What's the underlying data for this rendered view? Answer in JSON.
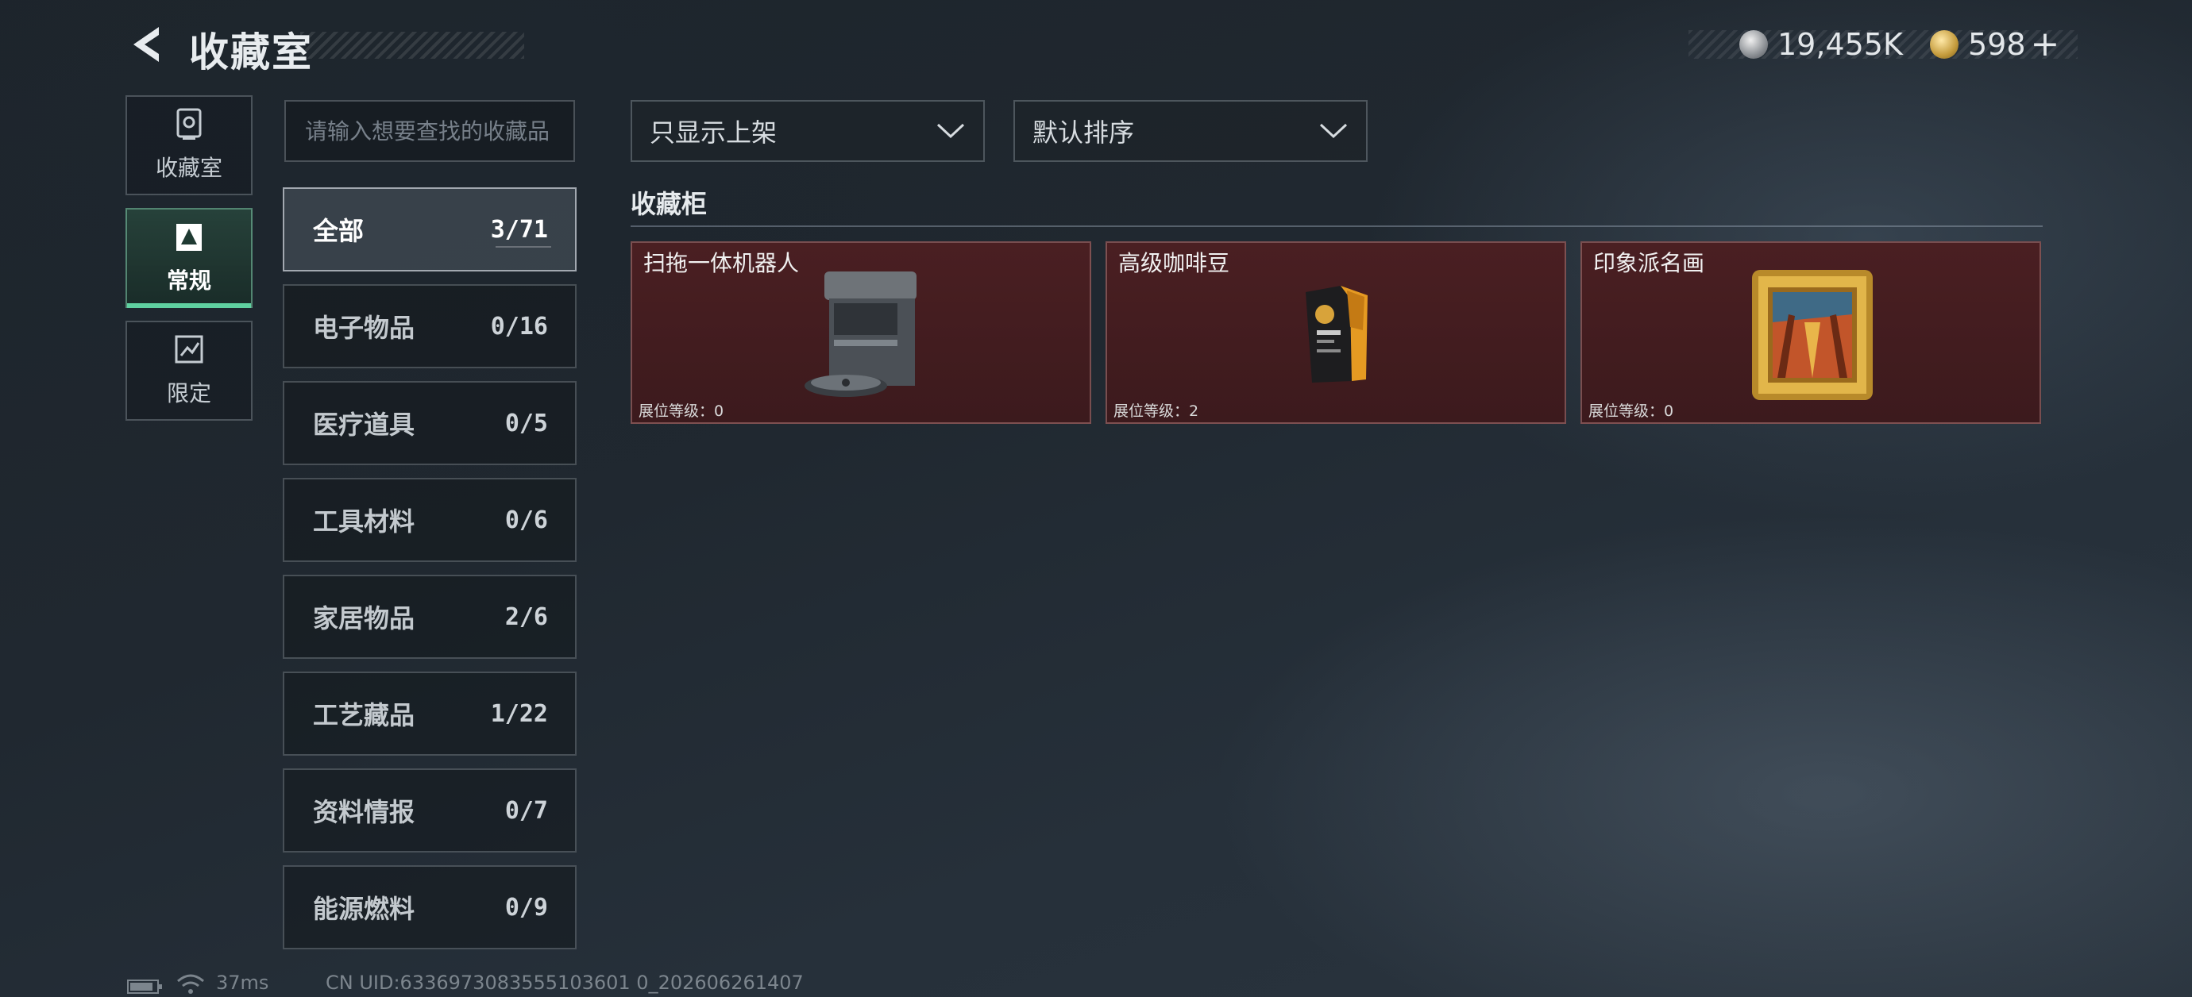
{
  "header": {
    "title": "收藏室",
    "currency": [
      {
        "icon": "silver-coin-icon",
        "value": "19,455K"
      },
      {
        "icon": "gold-coin-icon",
        "value": "598"
      }
    ],
    "plus": "+"
  },
  "nav": [
    {
      "label": "收藏室",
      "icon": "collection-room-icon",
      "active": false
    },
    {
      "label": "常规",
      "icon": "regular-icon",
      "active": true
    },
    {
      "label": "限定",
      "icon": "limited-icon",
      "active": false
    }
  ],
  "search": {
    "placeholder": "请输入想要查找的收藏品",
    "value": ""
  },
  "categories": [
    {
      "label": "全部",
      "count": "3/71",
      "active": true
    },
    {
      "label": "电子物品",
      "count": "0/16"
    },
    {
      "label": "医疗道具",
      "count": "0/5"
    },
    {
      "label": "工具材料",
      "count": "0/6"
    },
    {
      "label": "家居物品",
      "count": "2/6"
    },
    {
      "label": "工艺藏品",
      "count": "1/22"
    },
    {
      "label": "资料情报",
      "count": "0/7"
    },
    {
      "label": "能源燃料",
      "count": "0/9"
    }
  ],
  "filters": {
    "shelf": {
      "selected": "只显示上架"
    },
    "sort": {
      "selected": "默认排序"
    }
  },
  "section": {
    "title": "收藏柜"
  },
  "items": [
    {
      "name": "扫拖一体机器人",
      "level": "展位等级：0",
      "icon": "robot-vacuum-icon"
    },
    {
      "name": "高级咖啡豆",
      "level": "展位等级：2",
      "icon": "coffee-bag-icon"
    },
    {
      "name": "印象派名画",
      "level": "展位等级：0",
      "icon": "framed-painting-icon"
    }
  ],
  "status": {
    "ping": "37ms",
    "uid": "CN UID:6336973083555103601 0_202606261407"
  },
  "colors": {
    "accent": "#5fd0a0",
    "card_bg": "#4a1f22"
  }
}
